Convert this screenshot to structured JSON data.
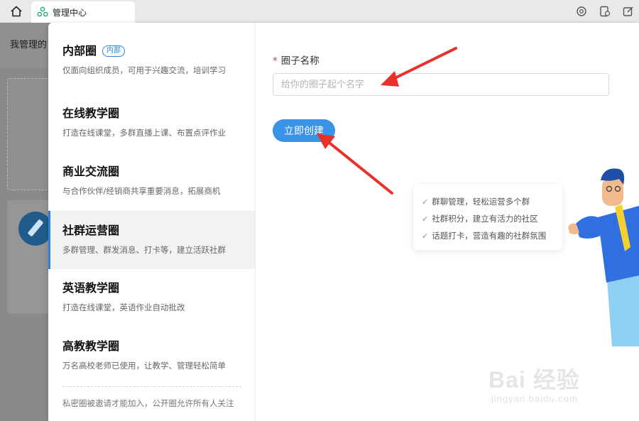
{
  "topbar": {
    "tab_title": "管理中心",
    "icons": [
      "home-icon",
      "circle-refresh-icon",
      "doc-clock-icon",
      "edit-window-icon"
    ]
  },
  "background": {
    "title": "我管理的"
  },
  "circle_types": [
    {
      "title": "内部圈",
      "badge": "内部",
      "desc": "仅面向组织成员，可用于兴趣交流，培训学习"
    },
    {
      "title": "在线教学圈",
      "desc": "打造在线课堂，多群直播上课、布置点评作业"
    },
    {
      "title": "商业交流圈",
      "desc": "与合作伙伴/经销商共享重要消息，拓展商机"
    },
    {
      "title": "社群运营圈",
      "desc": "多群管理、群发消息、打卡等，建立活跃社群"
    },
    {
      "title": "英语教学圈",
      "desc": "打造在线课堂，英语作业自动批改"
    },
    {
      "title": "高教教学圈",
      "desc": "万名高校老师已使用，让教学、管理轻松简单"
    }
  ],
  "selected_index": 3,
  "footnote": "私密圈被邀请才能加入，公开圈允许所有人关注",
  "form": {
    "required_mark": "*",
    "name_label": "圈子名称",
    "name_placeholder": "给你的圈子起个名字",
    "name_value": "",
    "create_button": "立即创建"
  },
  "features": [
    "群聊管理，轻松运营多个群",
    "社群积分，建立有活力的社区",
    "话题打卡，营造有趣的社群氛围"
  ],
  "watermark": {
    "logo": "Bai 经验",
    "url": "jingyan.baidu.com"
  },
  "colors": {
    "accent": "#3a93e8",
    "arrow": "#e8312a",
    "required": "#e23b3b"
  }
}
